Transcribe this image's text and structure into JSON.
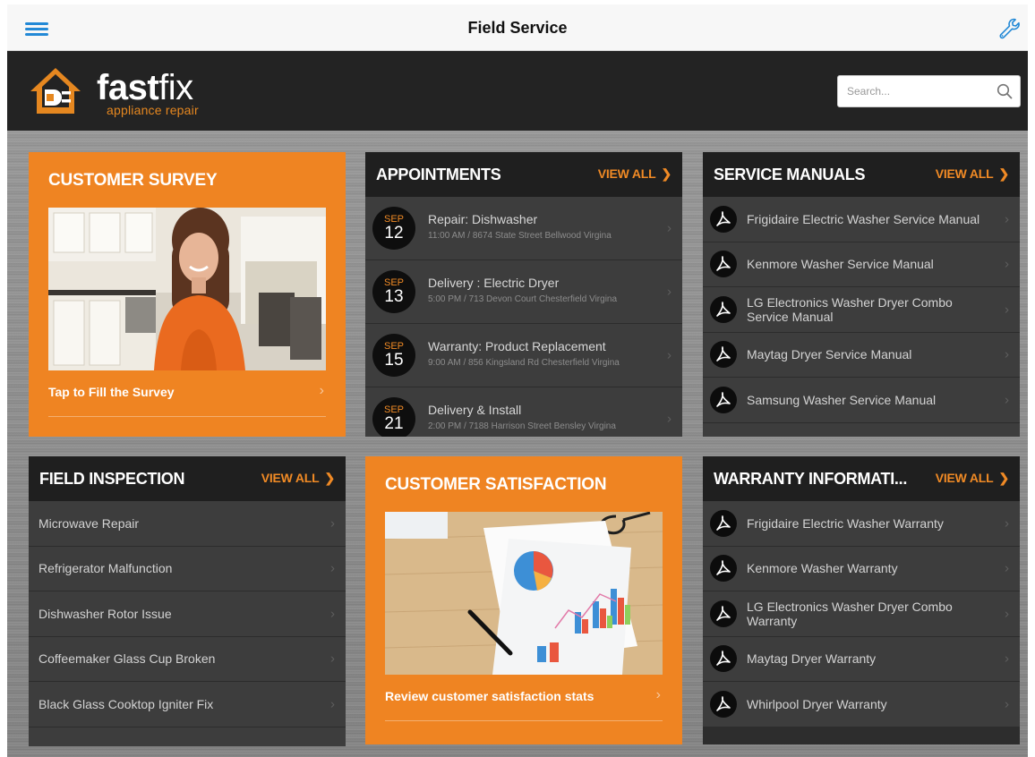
{
  "topbar": {
    "title": "Field Service"
  },
  "brand": {
    "name_bold": "fast",
    "name_light": "fix",
    "tagline": "appliance repair"
  },
  "search": {
    "placeholder": "Search..."
  },
  "colors": {
    "accent": "#ef8422",
    "nav_blue": "#2389d6",
    "header_bg": "#232323",
    "card_dark": "#3d3d3d"
  },
  "survey": {
    "title": "CUSTOMER SURVEY",
    "cta": "Tap to Fill the Survey"
  },
  "satisfaction": {
    "title": "CUSTOMER SATISFACTION",
    "cta": "Review customer satisfaction stats"
  },
  "appointments": {
    "title": "APPOINTMENTS",
    "view_all": "VIEW ALL",
    "items": [
      {
        "month": "SEP",
        "day": "12",
        "title": "Repair: Dishwasher",
        "detail": "11:00 AM / 8674 State Street Bellwood Virgina"
      },
      {
        "month": "SEP",
        "day": "13",
        "title": "Delivery : Electric Dryer",
        "detail": "5:00 PM / 713 Devon Court Chesterfield Virgina"
      },
      {
        "month": "SEP",
        "day": "15",
        "title": "Warranty: Product Replacement",
        "detail": "9:00 AM / 856 Kingsland Rd Chesterfield Virgina"
      },
      {
        "month": "SEP",
        "day": "21",
        "title": "Delivery & Install",
        "detail": "2:00 PM / 7188 Harrison Street Bensley Virgina"
      }
    ]
  },
  "manuals": {
    "title": "SERVICE MANUALS",
    "view_all": "VIEW ALL",
    "items": [
      "Frigidaire Electric Washer Service Manual",
      "Kenmore Washer Service Manual",
      "LG Electronics Washer Dryer Combo Service Manual",
      "Maytag Dryer Service Manual",
      "Samsung Washer Service Manual"
    ]
  },
  "inspection": {
    "title": "FIELD INSPECTION",
    "view_all": "VIEW ALL",
    "items": [
      "Microwave Repair",
      "Refrigerator Malfunction",
      "Dishwasher Rotor Issue",
      "Coffeemaker Glass Cup Broken",
      "Black Glass Cooktop Igniter Fix"
    ]
  },
  "warranty": {
    "title": "WARRANTY INFORMATI...",
    "view_all": "VIEW ALL",
    "items": [
      "Frigidaire Electric Washer Warranty",
      "Kenmore Washer Warranty",
      "LG Electronics Washer Dryer Combo Warranty",
      "Maytag Dryer Warranty",
      "Whirlpool Dryer Warranty"
    ]
  }
}
